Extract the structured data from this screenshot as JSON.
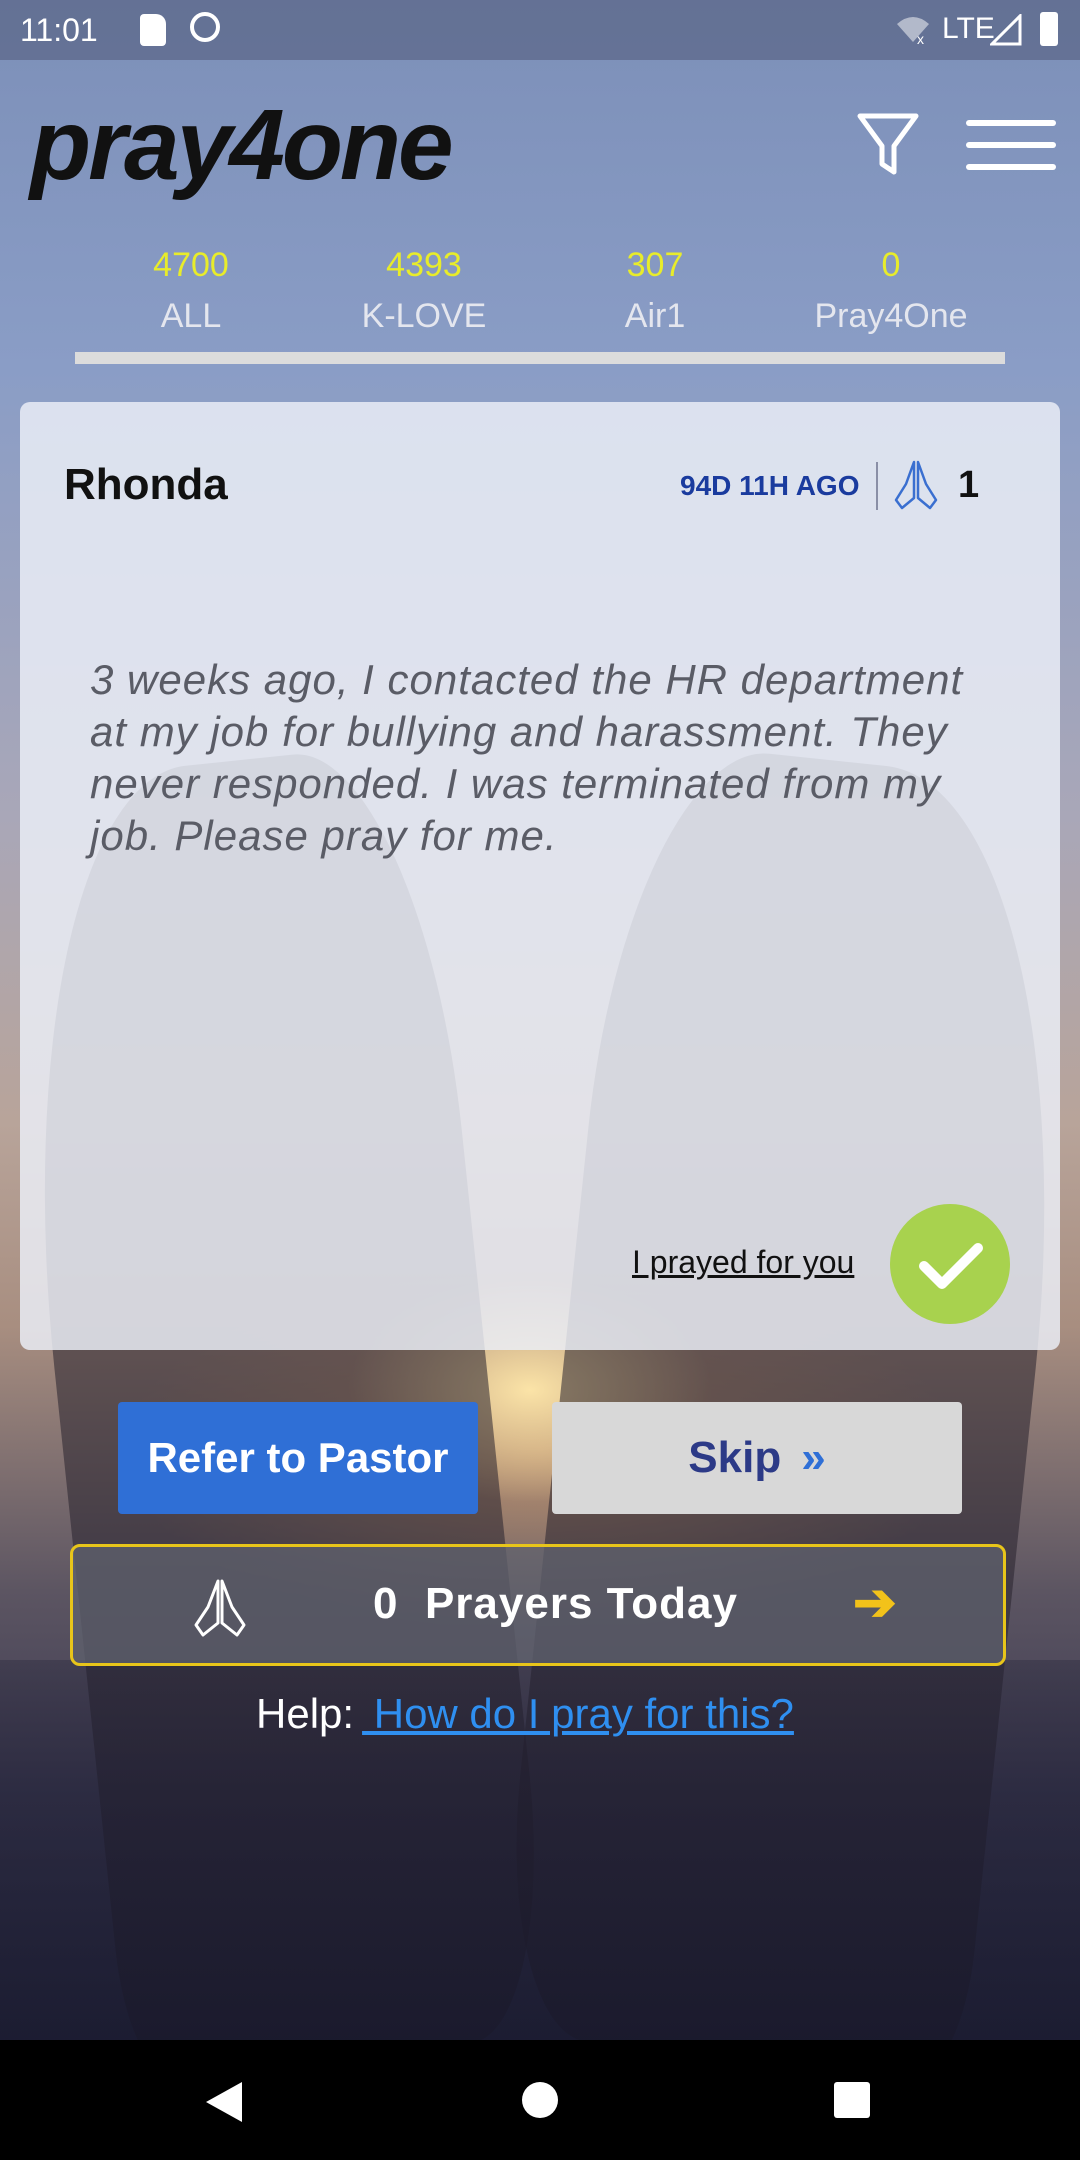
{
  "status_bar": {
    "time": "11:01",
    "network": "LTE"
  },
  "header": {
    "logo_text": "pray4one",
    "filter_icon": "filter-icon",
    "menu_icon": "hamburger-menu-icon"
  },
  "tabs": [
    {
      "count": "4700",
      "label": "ALL"
    },
    {
      "count": "4393",
      "label": "K-LOVE"
    },
    {
      "count": "307",
      "label": "Air1"
    },
    {
      "count": "0",
      "label": "Pray4One"
    }
  ],
  "card": {
    "name": "Rhonda",
    "ago": "94D 11H AGO",
    "pray_count": "1",
    "message": "3 weeks ago, I contacted the HR department at my job for bullying and harassment. They never responded. I was terminated from my job. Please pray for me.",
    "prayed_link": "I prayed for you"
  },
  "actions": {
    "refer_label": "Refer to Pastor",
    "skip_label": "Skip",
    "skip_chevron": "»"
  },
  "prayers_today": {
    "count": "0",
    "label": "Prayers Today",
    "arrow": "➔"
  },
  "help": {
    "prefix": "Help:",
    "link": " How do I pray for this?"
  },
  "colors": {
    "accent_yellow": "#e8ec2a",
    "primary_blue": "#2f6fd6",
    "check_green": "#a8d24e",
    "prayers_border": "#e8c51a"
  }
}
